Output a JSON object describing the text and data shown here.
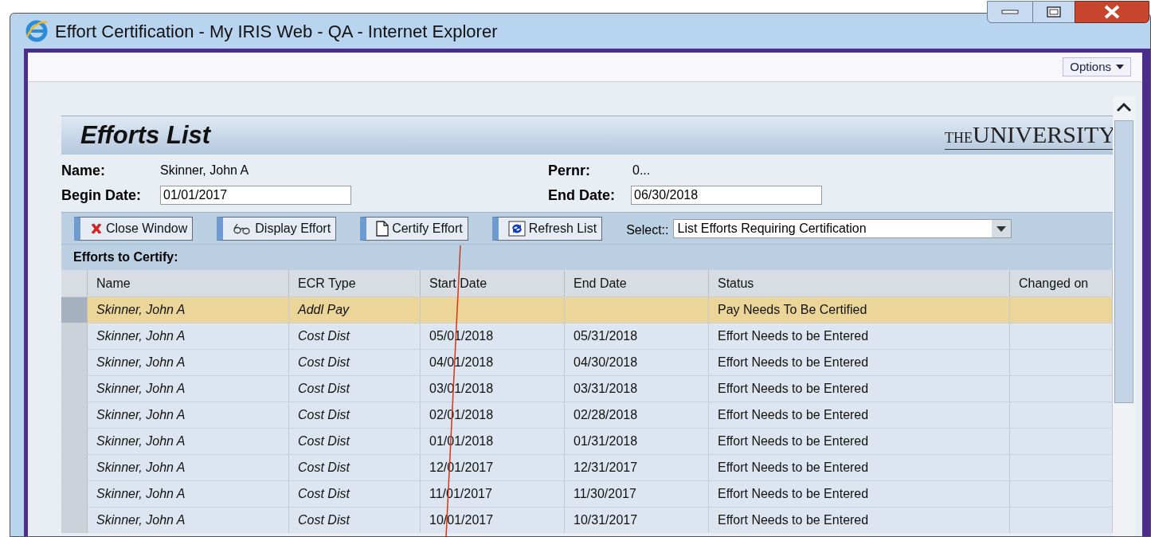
{
  "window": {
    "title": "Effort Certification - My IRIS Web - QA - Internet Explorer"
  },
  "options_button": {
    "label": "Options"
  },
  "header": {
    "title": "Efforts List",
    "logo_small": "THE",
    "logo_large": "UNIVERSITY"
  },
  "fields": {
    "name_label": "Name:",
    "name_value": "Skinner, John A",
    "pernr_label": "Pernr:",
    "pernr_value": "0...",
    "begin_label": "Begin Date:",
    "begin_value": "01/01/2017",
    "end_label": "End Date:",
    "end_value": "06/30/2018"
  },
  "toolbar": [
    {
      "kind": "close",
      "label": "Close Window"
    },
    {
      "kind": "display",
      "label": "Display Effort"
    },
    {
      "kind": "certify",
      "label": "Certify Effort"
    },
    {
      "kind": "refresh",
      "label": "Refresh List"
    }
  ],
  "select": {
    "label": "Select::",
    "value": "List Efforts Requiring Certification"
  },
  "section_title": "Efforts to Certify:",
  "table": {
    "columns": [
      "Name",
      "ECR Type",
      "Start Date",
      "End Date",
      "Status",
      "Changed on"
    ],
    "rows": [
      {
        "selected": true,
        "cells": [
          "Skinner, John A",
          "Addl Pay",
          "",
          "",
          "Pay Needs To Be Certified",
          ""
        ]
      },
      {
        "selected": false,
        "cells": [
          "Skinner, John A",
          "Cost Dist",
          "05/01/2018",
          "05/31/2018",
          "Effort Needs to be Entered",
          ""
        ]
      },
      {
        "selected": false,
        "cells": [
          "Skinner, John A",
          "Cost Dist",
          "04/01/2018",
          "04/30/2018",
          "Effort Needs to be Entered",
          ""
        ]
      },
      {
        "selected": false,
        "cells": [
          "Skinner, John A",
          "Cost Dist",
          "03/01/2018",
          "03/31/2018",
          "Effort Needs to be Entered",
          ""
        ]
      },
      {
        "selected": false,
        "cells": [
          "Skinner, John A",
          "Cost Dist",
          "02/01/2018",
          "02/28/2018",
          "Effort Needs to be Entered",
          ""
        ]
      },
      {
        "selected": false,
        "cells": [
          "Skinner, John A",
          "Cost Dist",
          "01/01/2018",
          "01/31/2018",
          "Effort Needs to be Entered",
          ""
        ]
      },
      {
        "selected": false,
        "cells": [
          "Skinner, John A",
          "Cost Dist",
          "12/01/2017",
          "12/31/2017",
          "Effort Needs to be Entered",
          ""
        ]
      },
      {
        "selected": false,
        "cells": [
          "Skinner, John A",
          "Cost Dist",
          "11/01/2017",
          "11/30/2017",
          "Effort Needs to be Entered",
          ""
        ]
      },
      {
        "selected": false,
        "cells": [
          "Skinner, John A",
          "Cost Dist",
          "10/01/2017",
          "10/31/2017",
          "Effort Needs to be Entered",
          ""
        ]
      }
    ]
  }
}
